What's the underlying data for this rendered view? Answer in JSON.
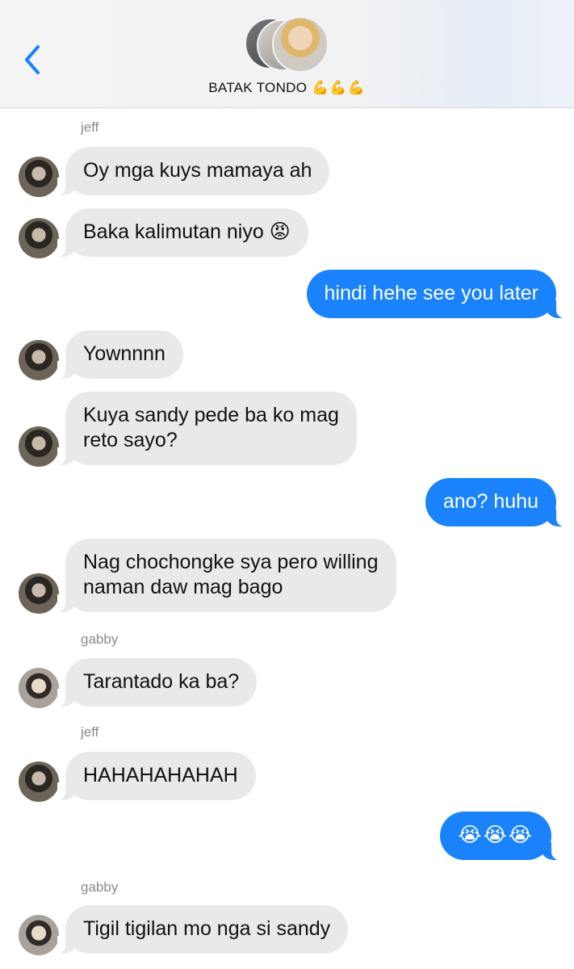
{
  "header": {
    "title": "BATAK TONDO",
    "title_emoji": "💪💪💪",
    "back_icon": "chevron-left-icon",
    "accent_color": "#1a82fb"
  },
  "messages": [
    {
      "sender": "jeff",
      "show_name": true,
      "text": "Oy mga kuys mamaya ah"
    },
    {
      "sender": "jeff",
      "text": "Baka kalimutan niyo 😡"
    },
    {
      "sender": "me",
      "text": "hindi hehe see you later"
    },
    {
      "sender": "jeff",
      "text": "Yownnnn"
    },
    {
      "sender": "jeff",
      "text": "Kuya sandy pede ba ko mag\nreto sayo?"
    },
    {
      "sender": "me",
      "text": "ano? huhu"
    },
    {
      "sender": "jeff",
      "text": "Nag chochongke sya pero willing\nnaman daw mag bago"
    },
    {
      "sender": "gabby",
      "show_name": true,
      "text": "Tarantado ka ba?"
    },
    {
      "sender": "jeff",
      "show_name": true,
      "text": "HAHAHAHAHAH"
    },
    {
      "sender": "me",
      "text": "😭😭😭"
    },
    {
      "sender": "gabby",
      "show_name": true,
      "text": "Tigil tigilan mo nga si sandy"
    }
  ],
  "names": {
    "jeff": "jeff",
    "gabby": "gabby"
  }
}
